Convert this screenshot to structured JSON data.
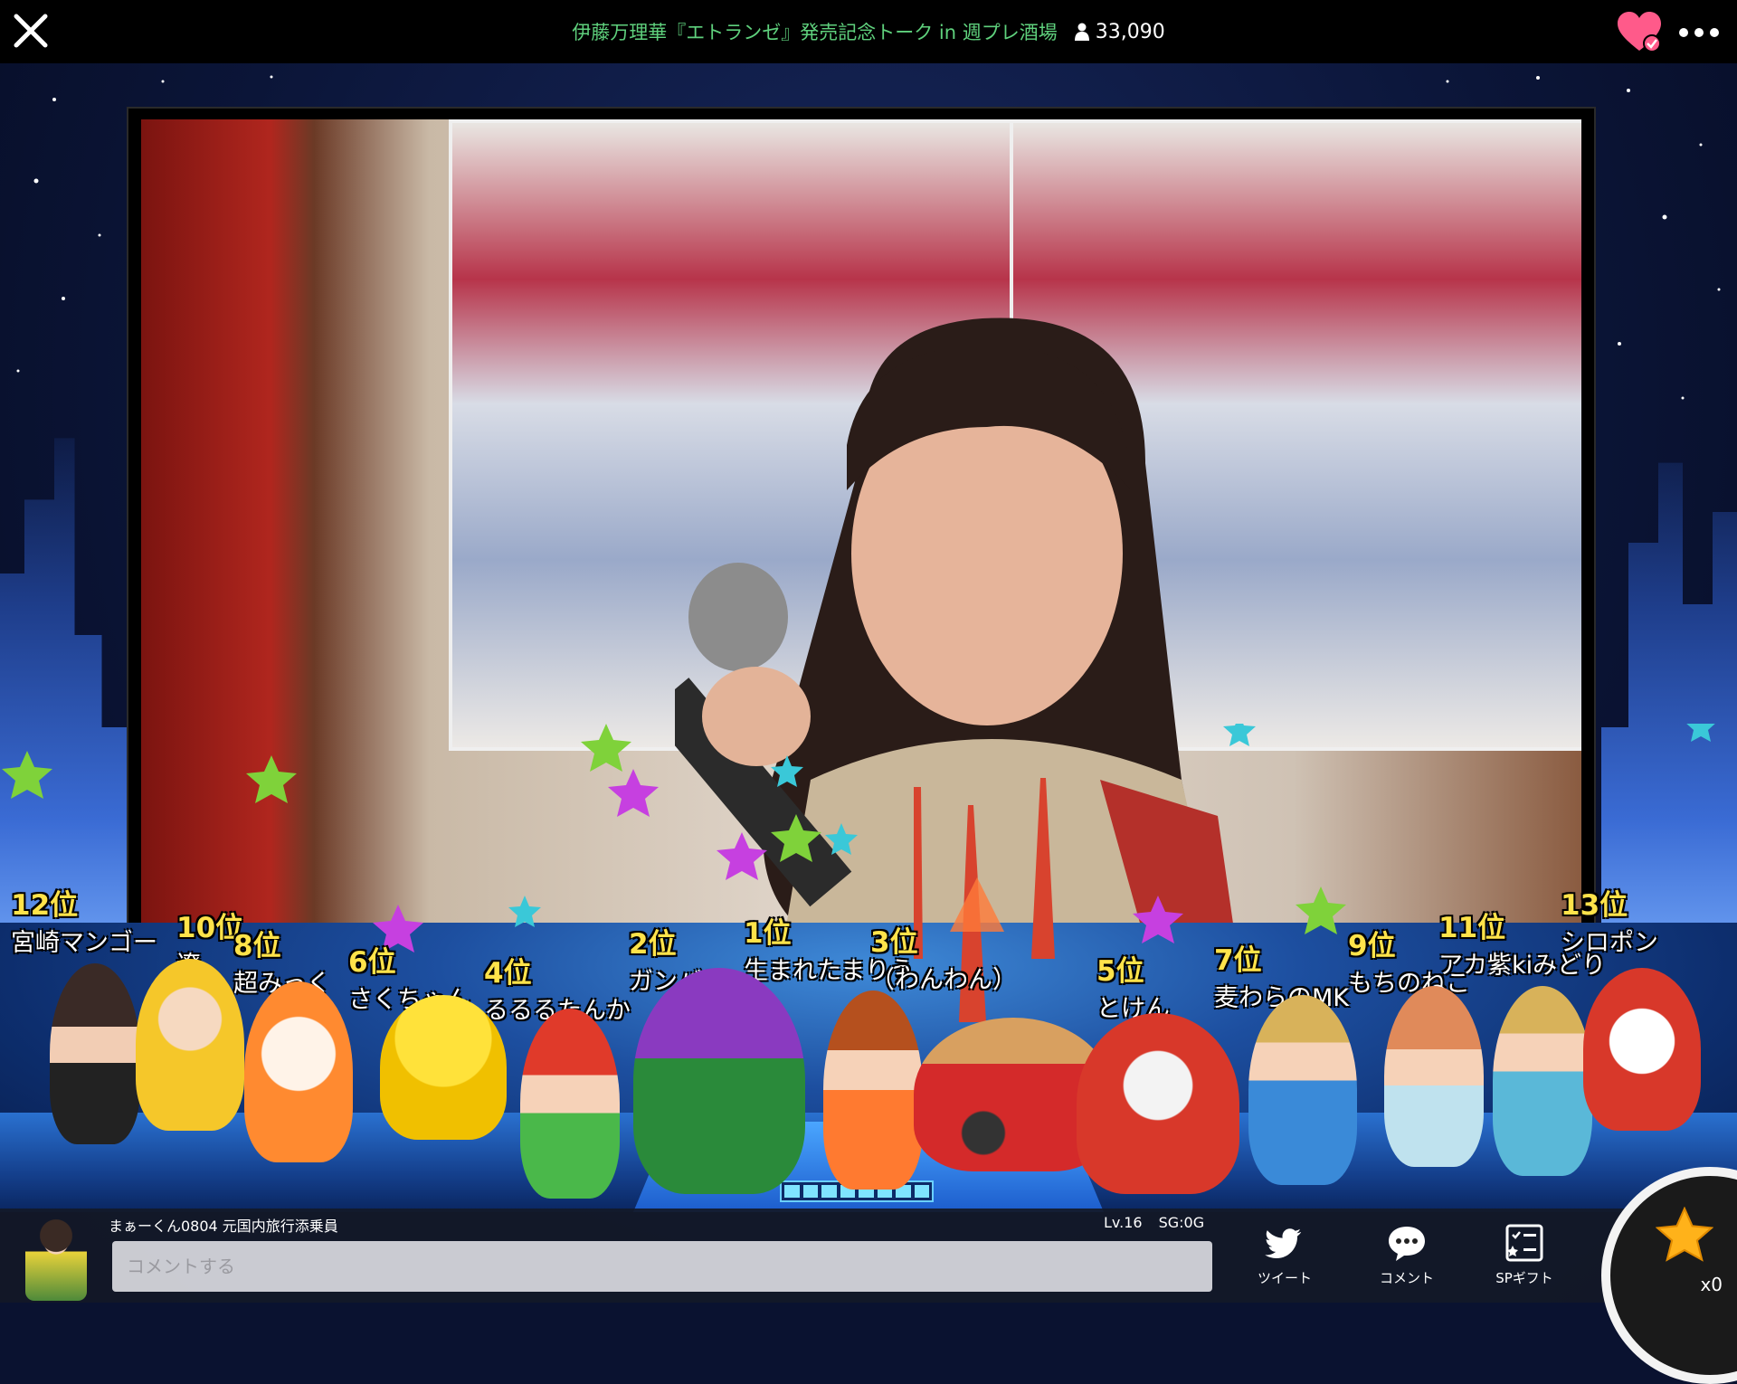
{
  "header": {
    "title": "伊藤万理華『エトランゼ』発売記念トーク in 週プレ酒場",
    "viewer_count": "33,090"
  },
  "ranking": [
    {
      "rank": "12位",
      "name": "宮崎マンゴー"
    },
    {
      "rank": "10位",
      "name": "遼"
    },
    {
      "rank": "8位",
      "name": "超みっく"
    },
    {
      "rank": "6位",
      "name": "さくちゃん"
    },
    {
      "rank": "4位",
      "name": "るるるたんか"
    },
    {
      "rank": "2位",
      "name": "ガンバレ◢"
    },
    {
      "rank": "1位",
      "name": "生まれたまりう"
    },
    {
      "rank": "3位",
      "name": "（わんわん）"
    },
    {
      "rank": "5位",
      "name": "とけん"
    },
    {
      "rank": "7位",
      "name": "麦わらのMK"
    },
    {
      "rank": "9位",
      "name": "もちのねこ"
    },
    {
      "rank": "11位",
      "name": "アカ紫kiみどり"
    },
    {
      "rank": "13位",
      "name": "シロポン"
    }
  ],
  "user": {
    "name": "まぁーくん0804 元国内旅行添乗員",
    "level": "Lv.16",
    "sg": "SG:0G"
  },
  "comment": {
    "placeholder": "コメントする"
  },
  "actions": {
    "tweet": "ツイート",
    "comment": "コメント",
    "sp_gift": "SPギフト"
  },
  "gift": {
    "count": "x0"
  },
  "colors": {
    "title_green": "#5fd17d",
    "rank_yellow": "#ffe34a",
    "heart_pink": "#ff5a8a"
  },
  "icons": [
    "close-icon",
    "person-icon",
    "heart-icon",
    "more-icon",
    "twitter-icon",
    "comment-bubble-icon",
    "gift-list-icon",
    "star-icon"
  ]
}
